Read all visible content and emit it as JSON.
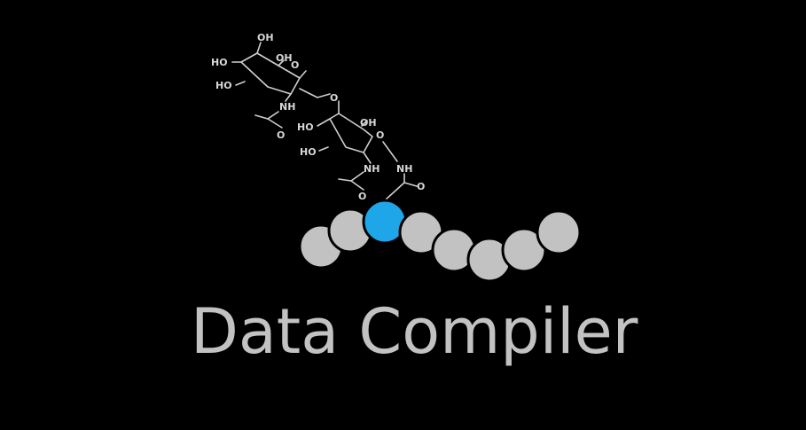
{
  "app": {
    "title": "Data Compiler"
  },
  "molecule": {
    "labels": {
      "hydroxyl": "OH",
      "hydroxyl_left": "HO",
      "amine": "NH",
      "oxygen": "O"
    }
  },
  "colors": {
    "background": "#000000",
    "title": "#c2c2c2",
    "bead": "#c2c2c2",
    "bead_highlight": "#1fa6e8",
    "molecule": "#d7d7d7"
  }
}
